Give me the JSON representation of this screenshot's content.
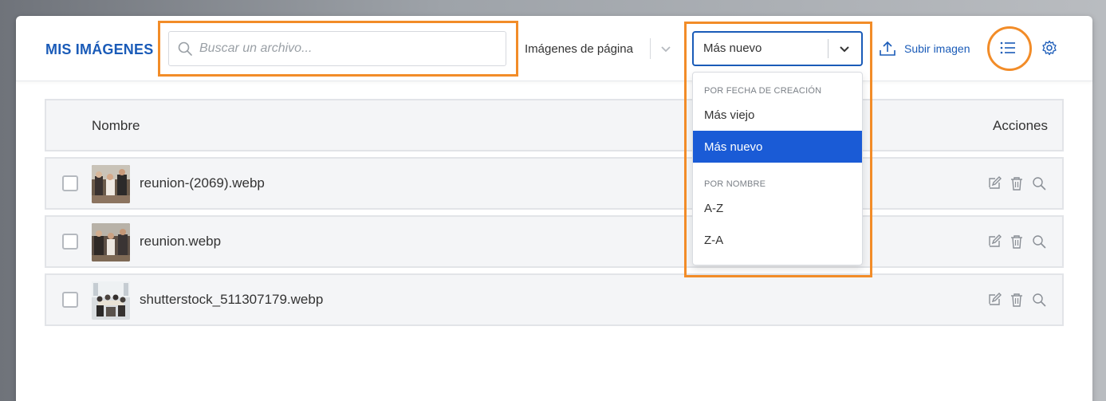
{
  "header": {
    "title": "MIS IMÁGENES",
    "search_placeholder": "Buscar un archivo...",
    "filter_value": "Imágenes de página",
    "sort_value": "Más nuevo",
    "upload_label": "Subir imagen"
  },
  "table": {
    "col_name": "Nombre",
    "col_actions": "Acciones",
    "rows": [
      {
        "filename": "reunion-(2069).webp"
      },
      {
        "filename": "reunion.webp"
      },
      {
        "filename": "shutterstock_511307179.webp"
      }
    ]
  },
  "dropdown": {
    "group_date": "POR FECHA DE CREACIÓN",
    "opt_oldest": "Más viejo",
    "opt_newest": "Más nuevo",
    "group_name": "POR NOMBRE",
    "opt_az": "A-Z",
    "opt_za": "Z-A"
  },
  "colors": {
    "accent": "#1a5bb8",
    "highlight": "#f28c28",
    "selected": "#1a5bd6"
  },
  "icons": [
    "search-icon",
    "chevron-down-icon",
    "upload-icon",
    "list-view-icon",
    "gear-icon",
    "edit-icon",
    "trash-icon",
    "zoom-icon"
  ]
}
